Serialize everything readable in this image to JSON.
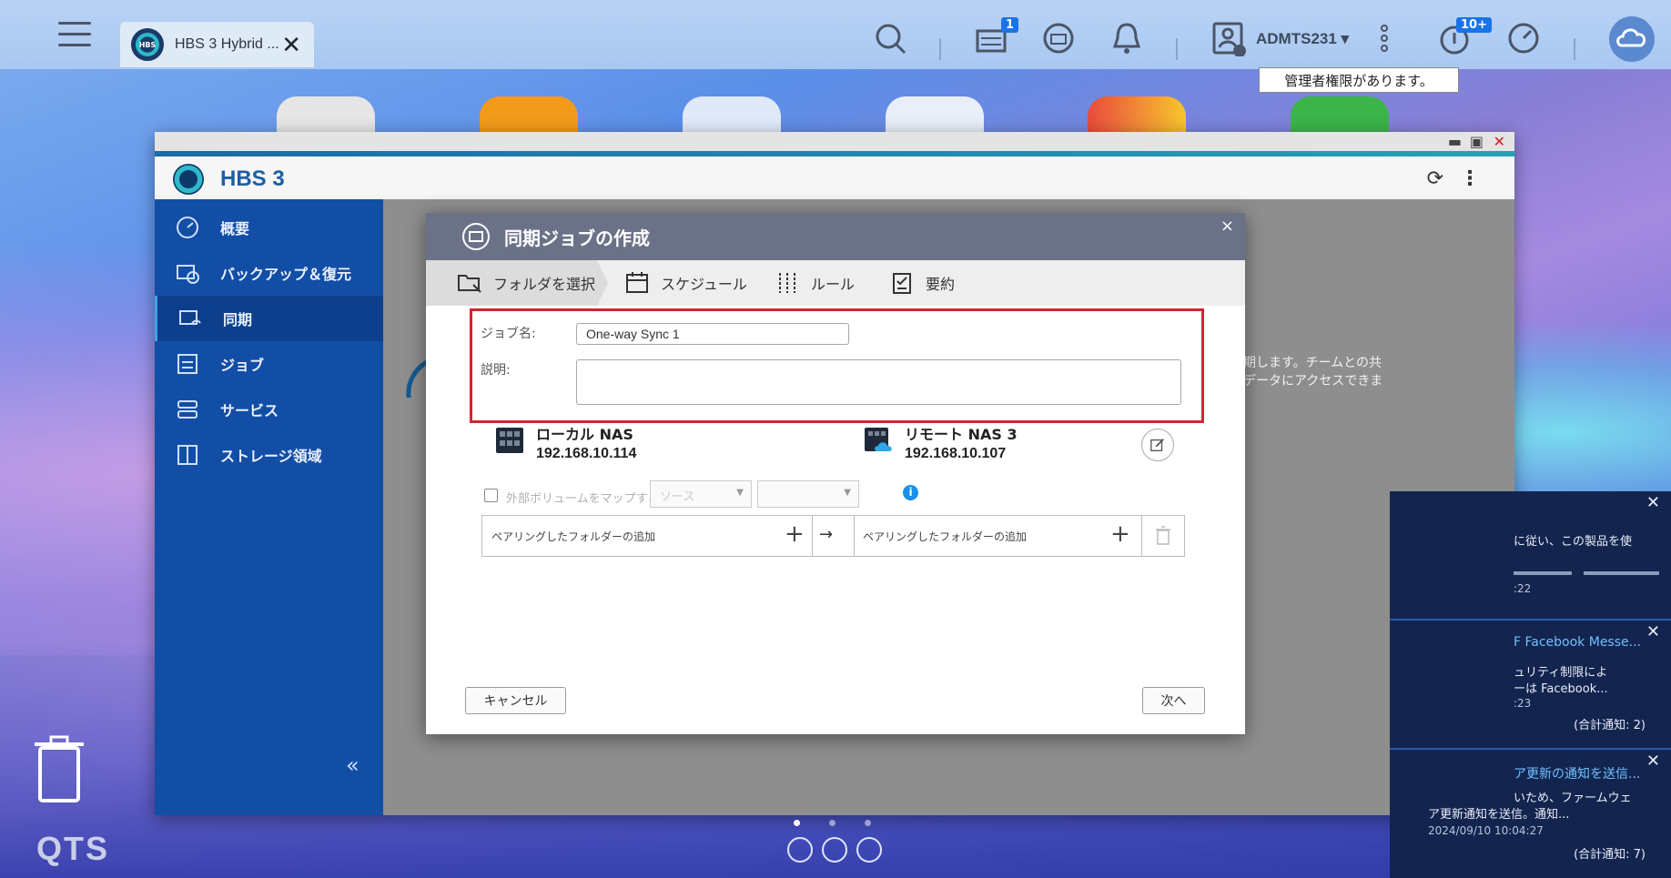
{
  "taskbar": {
    "tab_title": "HBS 3 Hybrid ...",
    "tab_logo_text": "HBS",
    "notify_badge": "1",
    "update_badge": "10+",
    "user_name": "ADMTS231 ▾",
    "tooltip": "管理者権限があります。"
  },
  "window": {
    "app_name": "HBS 3",
    "logo_text": "HBS"
  },
  "sidebar": {
    "items": [
      {
        "label": "概要",
        "icon": "dashboard-icon"
      },
      {
        "label": "バックアップ＆復元",
        "icon": "backup-restore-icon"
      },
      {
        "label": "同期",
        "icon": "sync-icon"
      },
      {
        "label": "ジョブ",
        "icon": "job-icon"
      },
      {
        "label": "サービス",
        "icon": "service-icon"
      },
      {
        "label": "ストレージ領域",
        "icon": "storage-icon"
      }
    ],
    "active_index": 2,
    "collapse": "«"
  },
  "background_text": {
    "line1": "ービス間で同期します。チームとの共",
    "line2": "たらいつでもデータにアクセスできま"
  },
  "dialog": {
    "title": "同期ジョブの作成",
    "steps": [
      "フォルダを選択",
      "スケジュール",
      "ルール",
      "要約"
    ],
    "job_name_label": "ジョブ名:",
    "job_name_value": "One-way Sync 1",
    "description_label": "説明:",
    "description_value": "",
    "local": {
      "title": "ローカル NAS",
      "ip": "192.168.10.114"
    },
    "remote": {
      "title": "リモート NAS 3",
      "ip": "192.168.10.107"
    },
    "map_external_label": "外部ボリュームをマップする",
    "source_placeholder": "ソース",
    "pair_left": "ペアリングしたフォルダーの追加",
    "pair_right": "ペアリングしたフォルダーの追加",
    "arrow": "→",
    "cancel": "キャンセル",
    "next": "次へ"
  },
  "notifications": [
    {
      "title": "",
      "body1": "に従い、この製品を使",
      "body2": "",
      "time": ":22",
      "total": ""
    },
    {
      "title": "F Facebook Messe...",
      "body1": "ュリティ制限によ",
      "body2": "ーは Facebook...",
      "time": ":23",
      "total": "(合計通知: 2)"
    },
    {
      "title": "ア更新の通知を送信...",
      "body1": "いため、ファームウェ",
      "body2": "ア更新通知を送信。通知...",
      "time": "2024/09/10 10:04:27",
      "total": "(合計通知: 7)"
    }
  ],
  "desktop": {
    "os_name": "QTS"
  }
}
